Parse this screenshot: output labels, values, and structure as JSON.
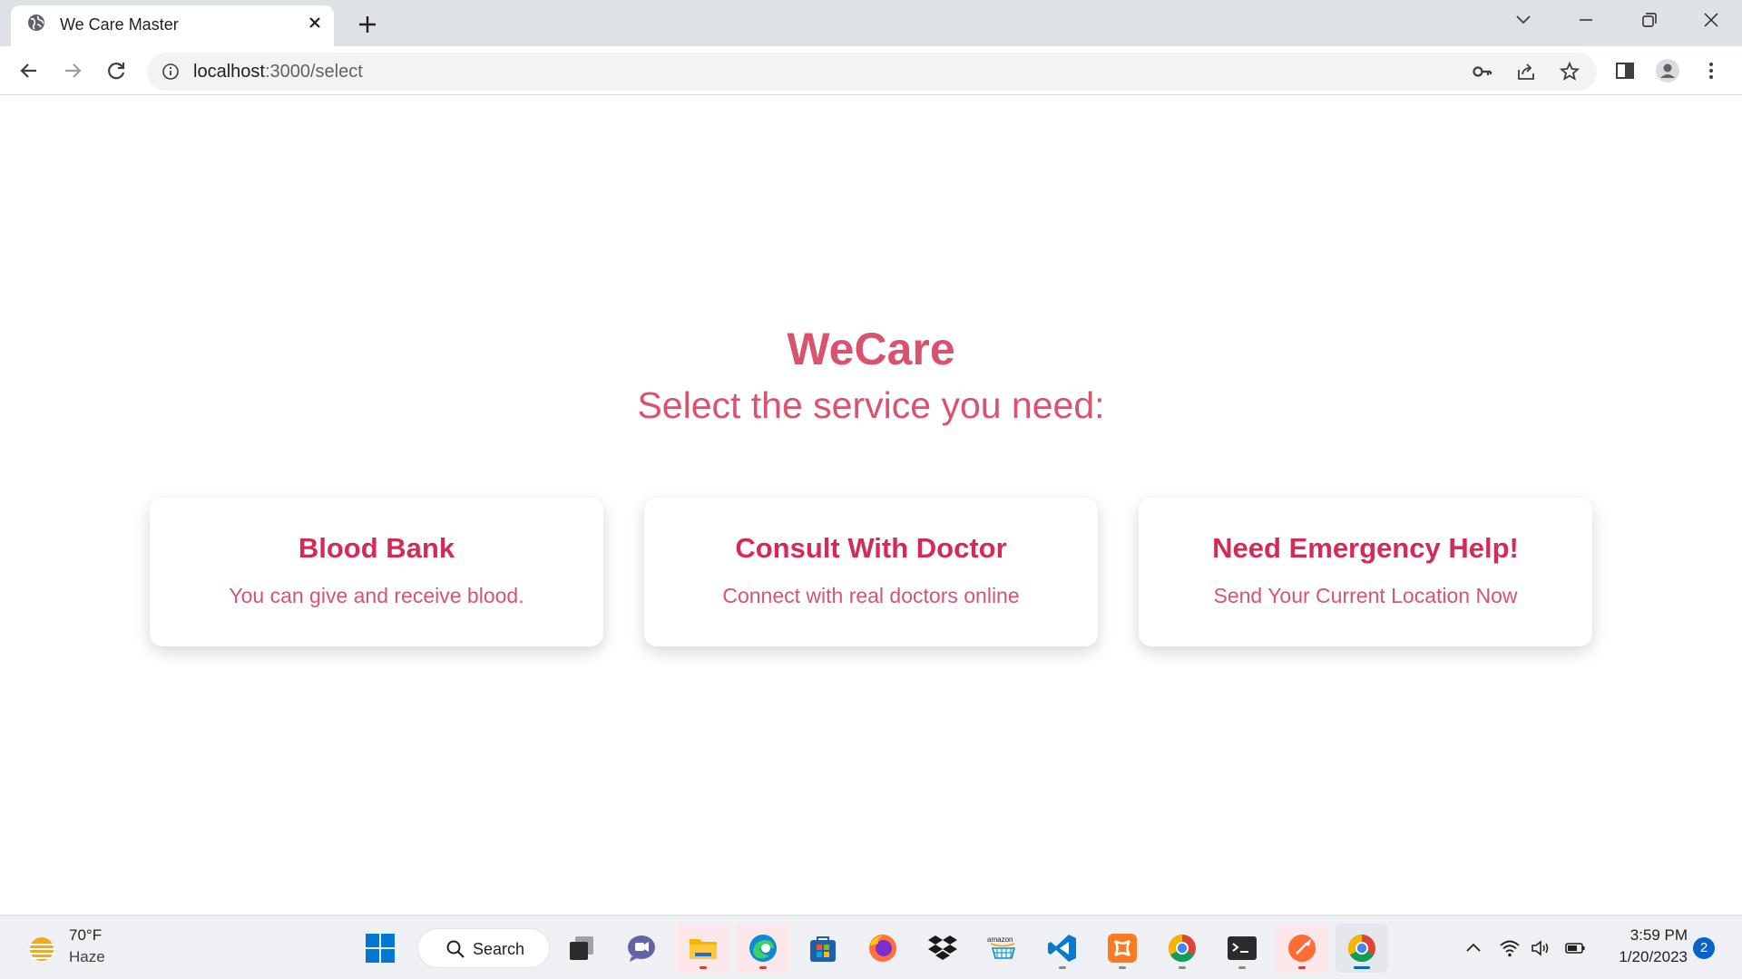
{
  "browser": {
    "tab_title": "We Care Master",
    "url_host": "localhost",
    "url_path": ":3000/select"
  },
  "page": {
    "brand": "WeCare",
    "subtitle": "Select the service you need:",
    "cards": [
      {
        "title": "Blood Bank",
        "description": "You can give and receive blood."
      },
      {
        "title": "Consult With Doctor",
        "description": "Connect with real doctors online"
      },
      {
        "title": "Need Emergency Help!",
        "description": "Send Your Current Location Now"
      }
    ],
    "colors": {
      "brand": "#d9536f",
      "card_title": "#d42a56"
    }
  },
  "taskbar": {
    "weather_temp": "70°F",
    "weather_condition": "Haze",
    "search_label": "Search",
    "time": "3:59 PM",
    "date": "1/20/2023",
    "notification_count": "2",
    "amazon_label": "amazon"
  }
}
